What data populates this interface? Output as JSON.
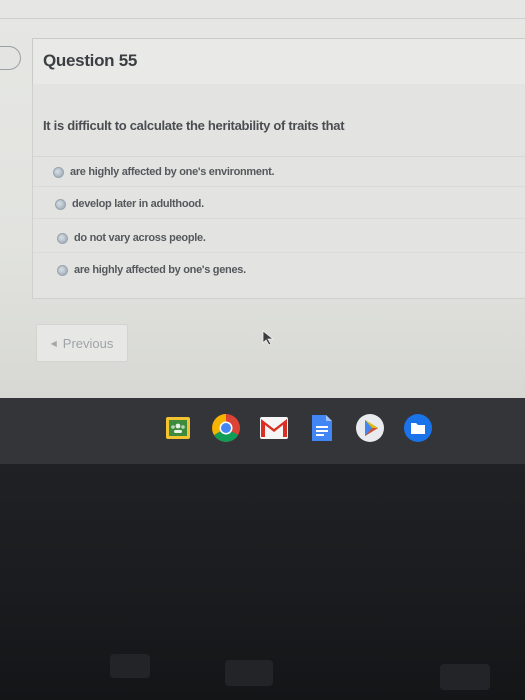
{
  "question": {
    "title": "Question 55",
    "prompt": "It is difficult to calculate the heritability of traits that",
    "options": [
      {
        "label": "are highly affected by one's environment."
      },
      {
        "label": "develop later in adulthood."
      },
      {
        "label": "do not vary across people."
      },
      {
        "label": "are highly affected by one's genes."
      }
    ]
  },
  "nav": {
    "previous_label": "Previous"
  },
  "shelf": {
    "apps": [
      "google-classroom-icon",
      "chrome-icon",
      "gmail-icon",
      "google-docs-icon",
      "google-play-icon",
      "files-icon"
    ]
  },
  "colors": {
    "screen_bg": "#e3e4e1",
    "title_text": "#3b3e43",
    "shelf_bg": "#333538"
  }
}
